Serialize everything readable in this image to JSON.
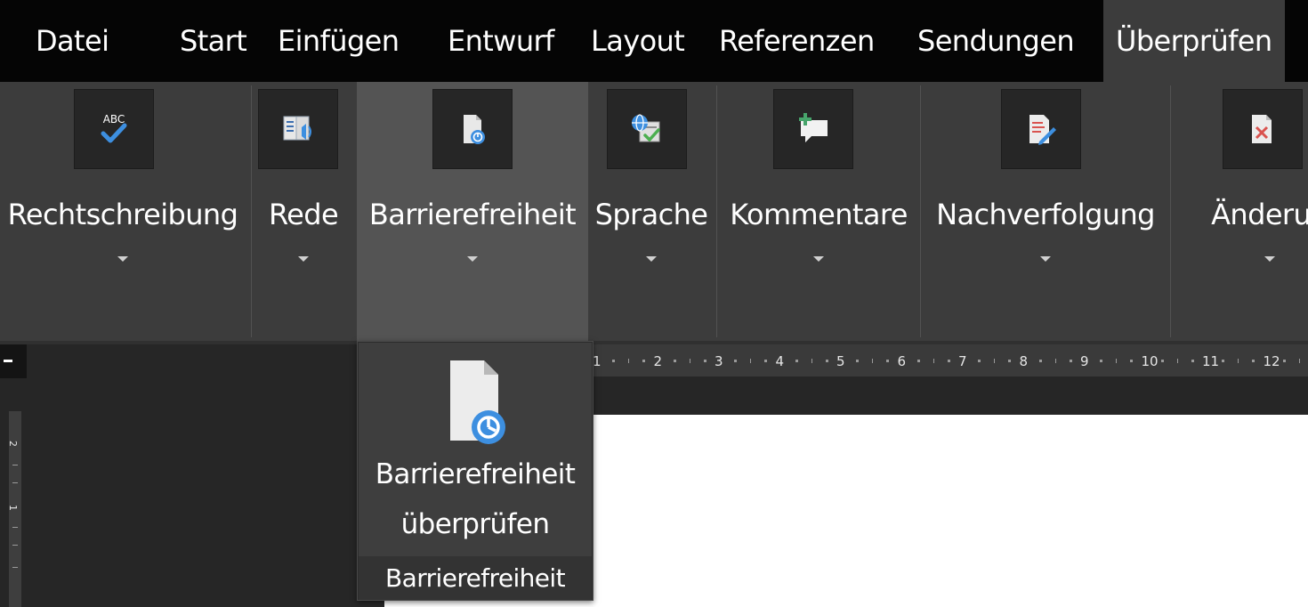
{
  "tabs": [
    {
      "label": "Datei"
    },
    {
      "label": "Start"
    },
    {
      "label": "Einfügen"
    },
    {
      "label": "Entwurf"
    },
    {
      "label": "Layout"
    },
    {
      "label": "Referenzen"
    },
    {
      "label": "Sendungen"
    },
    {
      "label": "Überprüfen",
      "active": true
    }
  ],
  "ribbon": {
    "groups": [
      {
        "label": "Rechtschreibung",
        "icon": "spelling-abc-check-icon"
      },
      {
        "label": "Rede",
        "icon": "read-aloud-icon"
      },
      {
        "label": "Barrierefreiheit",
        "icon": "accessibility-check-icon",
        "active": true
      },
      {
        "label": "Sprache",
        "icon": "language-icon"
      },
      {
        "label": "Kommentare",
        "icon": "new-comment-icon"
      },
      {
        "label": "Nachverfolgung",
        "icon": "track-changes-icon"
      },
      {
        "label": "Änderun",
        "icon": "reject-change-icon"
      }
    ]
  },
  "dropdown": {
    "item_line1": "Barrierefreiheit",
    "item_line2": "überprüfen",
    "item_icon": "accessibility-check-icon",
    "footer": "Barrierefreiheit"
  },
  "ruler": {
    "top_numbers": [
      "1",
      "2",
      "3",
      "4",
      "5",
      "6",
      "7",
      "8",
      "9",
      "10",
      "11",
      "12"
    ],
    "left_numbers": [
      "2",
      "1"
    ]
  },
  "colors": {
    "tabbar_bg": "#050505",
    "ribbon_bg": "#3c3c3c",
    "active_group_bg": "#545454",
    "accent_blue": "#3d8fe0",
    "document_bg": "#ffffff"
  }
}
